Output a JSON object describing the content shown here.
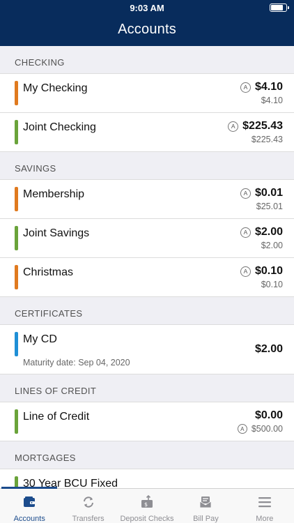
{
  "status_bar": {
    "time": "9:03 AM",
    "battery_level": 0.8
  },
  "header": {
    "title": "Accounts"
  },
  "colors": {
    "header_bg": "#082c5c",
    "checking_bar": "#e07a1f",
    "green_bar": "#6aa33a",
    "blue_bar": "#1f8fd6",
    "active_tab": "#1c4c8c"
  },
  "sections": {
    "checking": {
      "title": "CHECKING",
      "accounts": [
        {
          "name": "My Checking",
          "available": "$4.10",
          "balance": "$4.10",
          "available_badge": "A",
          "bar_color": "orange"
        },
        {
          "name": "Joint Checking",
          "available": "$225.43",
          "balance": "$225.43",
          "available_badge": "A",
          "bar_color": "green"
        }
      ]
    },
    "savings": {
      "title": "SAVINGS",
      "accounts": [
        {
          "name": "Membership",
          "available": "$0.01",
          "balance": "$25.01",
          "available_badge": "A",
          "bar_color": "orange"
        },
        {
          "name": "Joint Savings",
          "available": "$2.00",
          "balance": "$2.00",
          "available_badge": "A",
          "bar_color": "green"
        },
        {
          "name": "Christmas",
          "available": "$0.10",
          "balance": "$0.10",
          "available_badge": "A",
          "bar_color": "orange"
        }
      ]
    },
    "certificates": {
      "title": "CERTIFICATES",
      "accounts": [
        {
          "name": "My CD",
          "detail": "Maturity date: Sep 04, 2020",
          "balance": "$2.00",
          "bar_color": "blue"
        }
      ]
    },
    "lines_of_credit": {
      "title": "LINES OF CREDIT",
      "accounts": [
        {
          "name": "Line of Credit",
          "balance": "$0.00",
          "available": "$500.00",
          "available_badge": "A",
          "bar_color": "green"
        }
      ]
    },
    "mortgages": {
      "title": "MORTGAGES",
      "accounts": [
        {
          "name": "30 Year BCU Fixed",
          "bar_color": "green"
        }
      ]
    }
  },
  "tabbar": {
    "items": [
      {
        "label": "Accounts",
        "icon": "wallet-icon",
        "active": true
      },
      {
        "label": "Transfers",
        "icon": "transfer-arrows-icon",
        "active": false
      },
      {
        "label": "Deposit Checks",
        "icon": "deposit-check-icon",
        "active": false
      },
      {
        "label": "Bill Pay",
        "icon": "bill-pay-envelope-icon",
        "active": false
      },
      {
        "label": "More",
        "icon": "menu-icon",
        "active": false
      }
    ]
  }
}
